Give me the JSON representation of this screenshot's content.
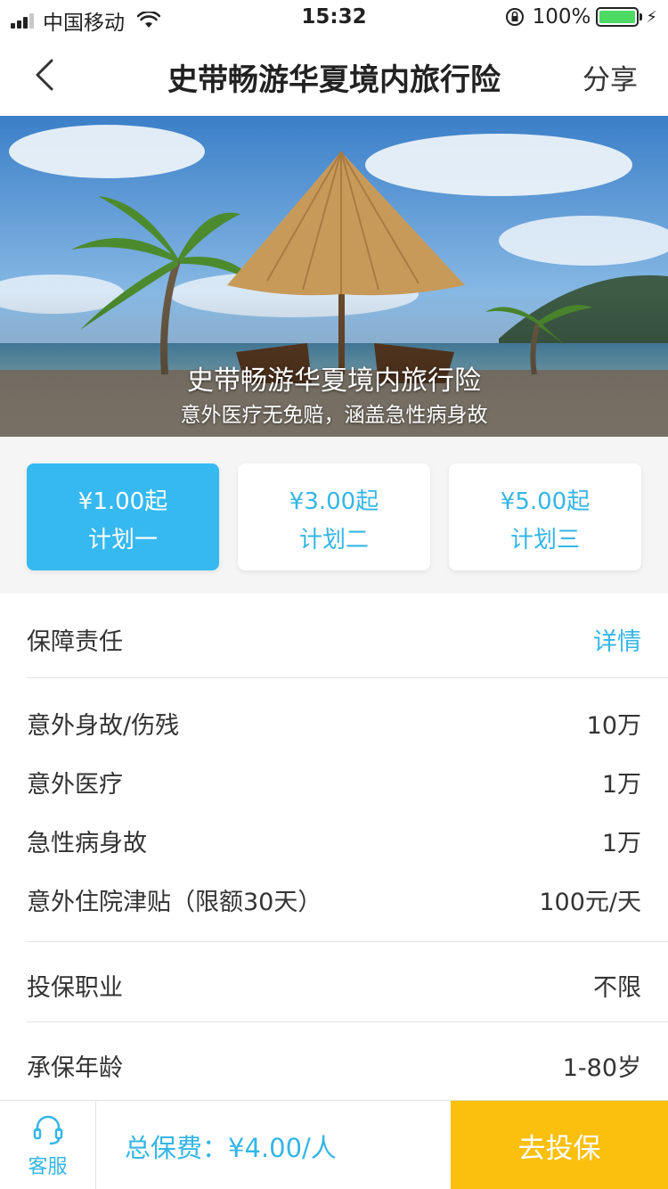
{
  "status_bar": {
    "carrier": "中国移动",
    "time": "15:32",
    "battery": "100%"
  },
  "nav": {
    "title": "史带畅游华夏境内旅行险",
    "share_label": "分享"
  },
  "hero": {
    "title": "史带畅游华夏境内旅行险",
    "subtitle": "意外医疗无免赔，涵盖急性病身故"
  },
  "plans": [
    {
      "price": "¥1.00起",
      "name": "计划一",
      "selected": true
    },
    {
      "price": "¥3.00起",
      "name": "计划二",
      "selected": false
    },
    {
      "price": "¥5.00起",
      "name": "计划三",
      "selected": false
    }
  ],
  "coverage": {
    "label": "保障责任",
    "detail_link": "详情",
    "items": [
      {
        "label": "意外身故/伤残",
        "value": "10万"
      },
      {
        "label": "意外医疗",
        "value": "1万"
      },
      {
        "label": "急性病身故",
        "value": "1万"
      },
      {
        "label": "意外住院津贴（限额30天）",
        "value": "100元/天"
      }
    ]
  },
  "occupation": {
    "label": "投保职业",
    "value": "不限"
  },
  "age": {
    "label": "承保年龄",
    "value": "1-80岁"
  },
  "bottom": {
    "service_label": "客服",
    "total_label": "总保费：¥4.00/人",
    "buy_label": "去投保"
  },
  "colors": {
    "accent": "#35b9f0",
    "buy_button": "#fbbf0e",
    "battery": "#4cd964"
  }
}
